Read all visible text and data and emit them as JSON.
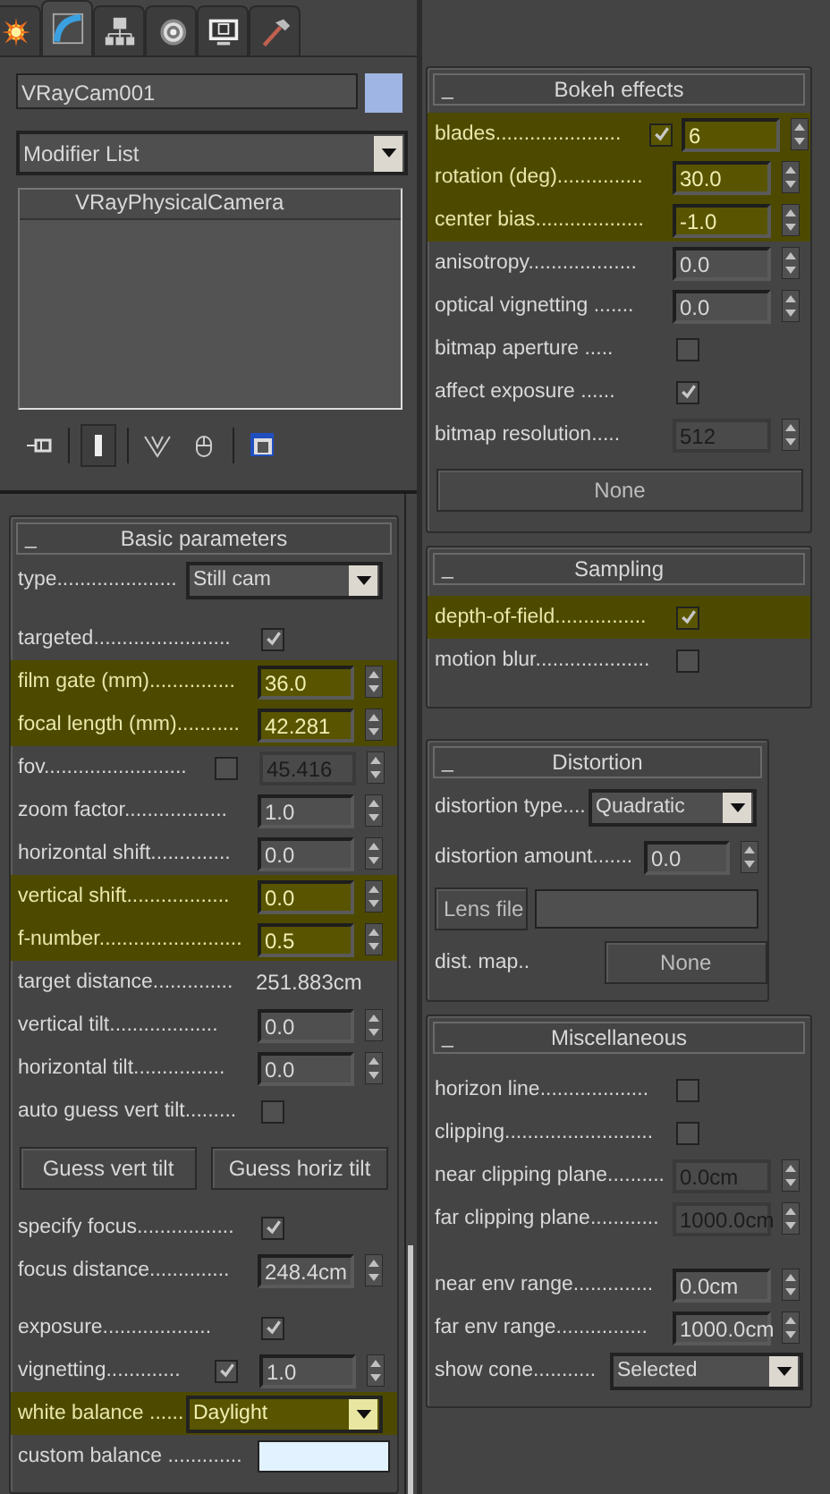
{
  "tabs": [
    {
      "selected": false
    },
    {
      "selected": true
    },
    {
      "selected": false
    },
    {
      "selected": false
    },
    {
      "selected": false
    },
    {
      "selected": false
    }
  ],
  "object": {
    "name": "VRayCam001",
    "color": "#9fb5e4"
  },
  "modifier_list": {
    "value": "Modifier List"
  },
  "stack": [
    {
      "label": "VRayPhysicalCamera"
    }
  ],
  "toolbar": [
    {
      "selected": false
    },
    {
      "selected": true
    },
    {
      "selected": false
    },
    {
      "selected": false
    },
    {
      "selected": false
    }
  ],
  "left_rollouts": [
    {
      "toggle": "_",
      "title": "Basic parameters",
      "rows": [
        {
          "kind": "dropdown",
          "label": "type.....................",
          "value": "Still cam",
          "highlighted": false
        },
        {
          "kind": "checkbox",
          "label": "targeted........................",
          "checked": true,
          "highlighted": false
        },
        {
          "kind": "spinner",
          "label": "film gate (mm)...............",
          "value": "36.0",
          "disabled": false,
          "highlighted": true
        },
        {
          "kind": "spinner",
          "label": "focal length (mm)...........",
          "value": "42.281",
          "disabled": false,
          "highlighted": true
        },
        {
          "kind": "check_spinner",
          "label": "fov.........................",
          "checked": false,
          "value": "45.416",
          "disabled": true,
          "highlighted": false
        },
        {
          "kind": "spinner",
          "label": "zoom factor..................",
          "value": "1.0",
          "disabled": false,
          "highlighted": false
        },
        {
          "kind": "spinner",
          "label": "horizontal shift..............",
          "value": "0.0",
          "disabled": false,
          "highlighted": false
        },
        {
          "kind": "spinner",
          "label": "vertical shift..................",
          "value": "0.0",
          "disabled": false,
          "highlighted": true
        },
        {
          "kind": "spinner",
          "label": "f-number.........................",
          "value": "0.5",
          "disabled": false,
          "highlighted": true
        },
        {
          "kind": "readout",
          "label": "target distance..............",
          "value": "251.883cm",
          "highlighted": false
        },
        {
          "kind": "spinner",
          "label": "vertical tilt...................",
          "value": "0.0",
          "disabled": false,
          "highlighted": false
        },
        {
          "kind": "spinner",
          "label": "horizontal tilt................",
          "value": "0.0",
          "disabled": false,
          "highlighted": false
        },
        {
          "kind": "checkbox",
          "label": "auto guess vert tilt.........",
          "checked": false,
          "highlighted": false
        },
        {
          "kind": "button_pair",
          "buttons": [
            "Guess vert tilt",
            "Guess horiz tilt"
          ],
          "highlighted": false
        },
        {
          "kind": "checkbox",
          "label": "specify focus.................",
          "checked": true,
          "highlighted": false
        },
        {
          "kind": "spinner",
          "label": "focus distance..............",
          "value": "248.4cm",
          "disabled": false,
          "highlighted": false
        },
        {
          "kind": "checkbox",
          "label": "exposure...................",
          "checked": true,
          "highlighted": false
        },
        {
          "kind": "check_spinner",
          "label": "vignetting.............",
          "checked": true,
          "value": "1.0",
          "disabled": false,
          "highlighted": false
        },
        {
          "kind": "dropdown",
          "label": "white balance ......",
          "value": "Daylight",
          "highlighted": true
        },
        {
          "kind": "swatch",
          "label": "custom balance .............",
          "color": "#e2f2ff",
          "highlighted": false
        }
      ]
    }
  ],
  "right_rollouts": [
    {
      "toggle": "_",
      "title": "Bokeh effects",
      "rows": [
        {
          "kind": "check_spinner",
          "label": "blades......................",
          "checked": true,
          "value": "6",
          "disabled": false,
          "highlighted": true
        },
        {
          "kind": "spinner",
          "label": "rotation (deg)...............",
          "value": "30.0",
          "disabled": false,
          "highlighted": true
        },
        {
          "kind": "spinner",
          "label": "center bias...................",
          "value": "-1.0",
          "disabled": false,
          "highlighted": true
        },
        {
          "kind": "spinner",
          "label": "anisotropy...................",
          "value": "0.0",
          "disabled": false,
          "highlighted": false
        },
        {
          "kind": "spinner",
          "label": "optical vignetting .......",
          "value": "0.0",
          "disabled": false,
          "highlighted": false
        },
        {
          "kind": "checkbox",
          "label": "bitmap aperture .....",
          "checked": false,
          "highlighted": false
        },
        {
          "kind": "checkbox",
          "label": "affect exposure ......",
          "checked": true,
          "highlighted": false
        },
        {
          "kind": "spinner",
          "label": "bitmap resolution.....",
          "value": "512",
          "disabled": true,
          "highlighted": false
        },
        {
          "kind": "button",
          "value": "None",
          "highlighted": false
        }
      ]
    },
    {
      "toggle": "_",
      "title": "Sampling",
      "rows": [
        {
          "kind": "checkbox",
          "label": "depth-of-field................",
          "checked": true,
          "highlighted": true
        },
        {
          "kind": "checkbox",
          "label": "motion blur....................",
          "checked": false,
          "highlighted": false
        }
      ]
    },
    {
      "toggle": "_",
      "title": "Distortion",
      "rows": [
        {
          "kind": "dropdown",
          "label": "distortion type....",
          "value": "Quadratic",
          "highlighted": false
        },
        {
          "kind": "spinner",
          "label": "distortion amount.......",
          "value": "0.0",
          "disabled": false,
          "highlighted": false
        },
        {
          "kind": "file",
          "value": "Lens file",
          "highlighted": false
        },
        {
          "kind": "map",
          "label": "dist. map..",
          "value": "None",
          "highlighted": false
        }
      ]
    },
    {
      "toggle": "_",
      "title": "Miscellaneous",
      "rows": [
        {
          "kind": "checkbox",
          "label": "horizon line...................",
          "checked": false,
          "highlighted": false
        },
        {
          "kind": "checkbox",
          "label": "clipping..........................",
          "checked": false,
          "highlighted": false
        },
        {
          "kind": "spinner",
          "label": "near clipping plane..........",
          "value": "0.0cm",
          "disabled": true,
          "highlighted": false
        },
        {
          "kind": "spinner",
          "label": "far clipping plane............",
          "value": "1000.0cm",
          "disabled": true,
          "highlighted": false
        },
        {
          "kind": "spinner",
          "label": "near env range..............",
          "value": "0.0cm",
          "disabled": false,
          "highlighted": false
        },
        {
          "kind": "spinner",
          "label": "far env range................",
          "value": "1000.0cm",
          "disabled": false,
          "highlighted": false
        },
        {
          "kind": "dropdown",
          "label": "show cone...........",
          "value": "Selected",
          "highlighted": false
        }
      ]
    }
  ]
}
